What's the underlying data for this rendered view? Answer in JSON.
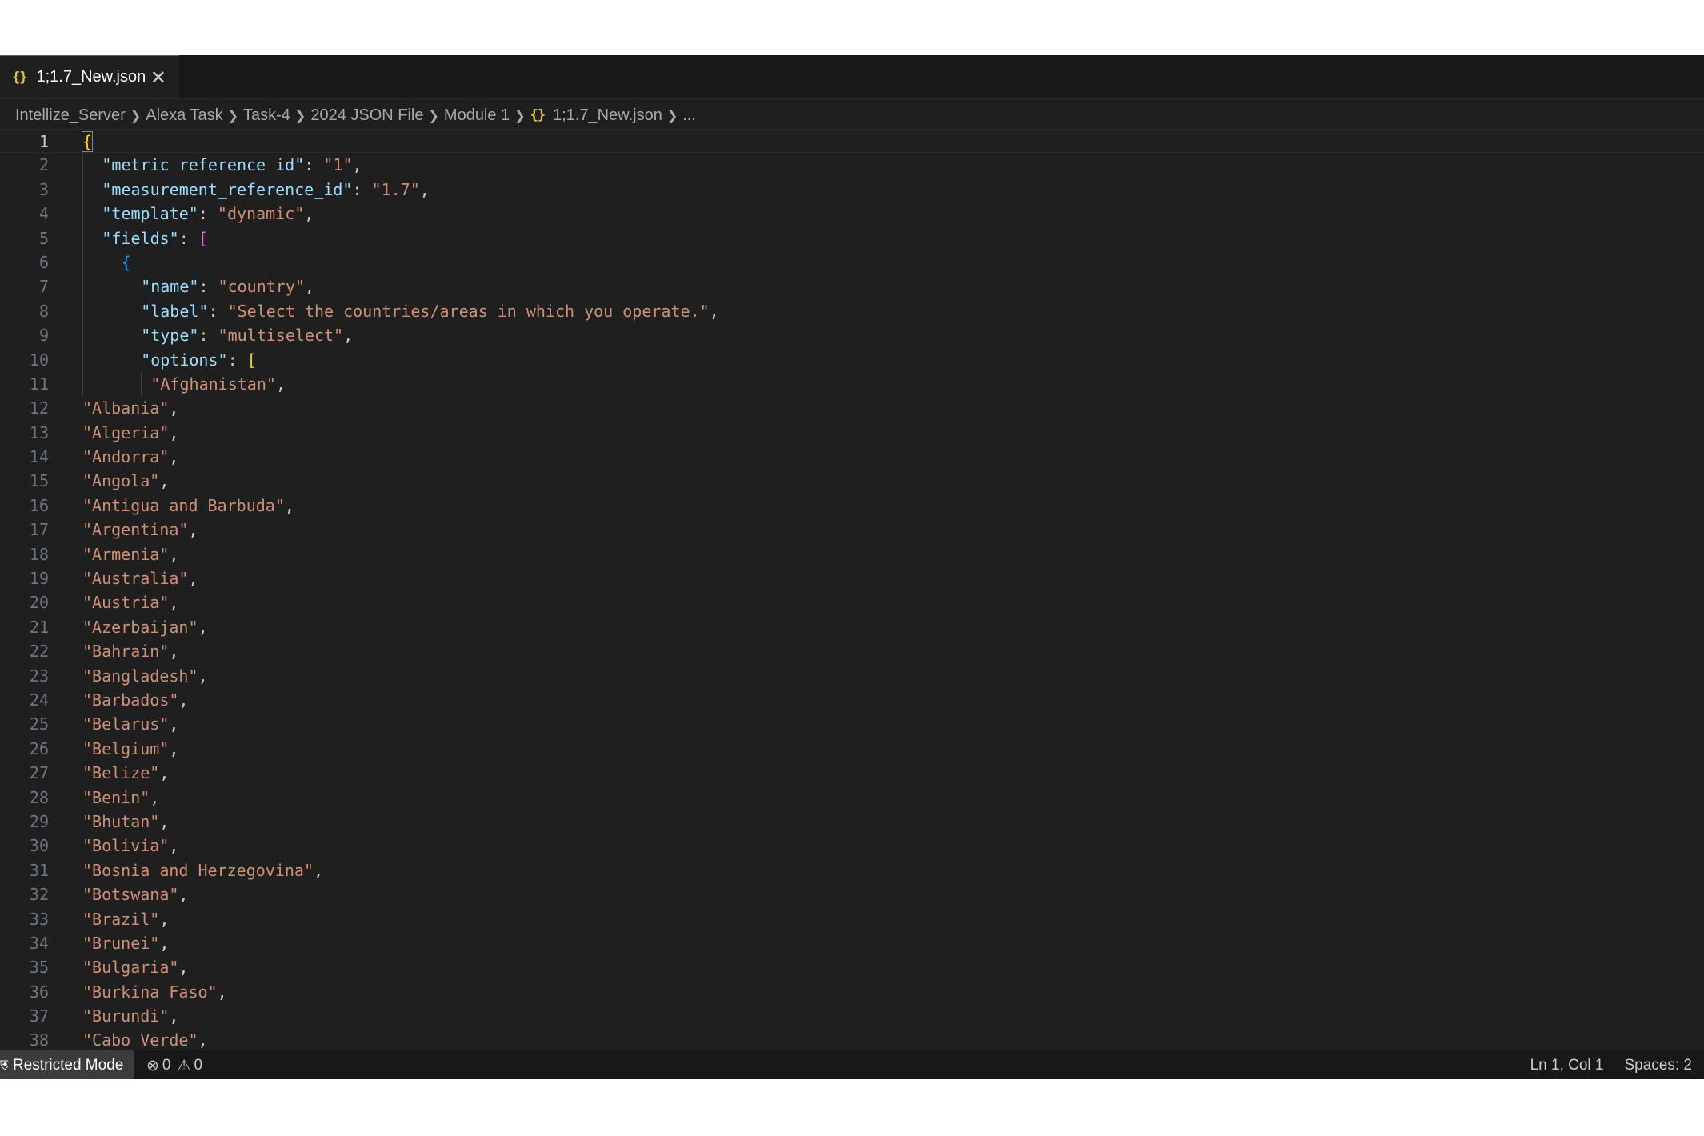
{
  "tab": {
    "icon": "json-braces-icon",
    "icon_text": "{}",
    "filename": "1;1.7_New.json",
    "close_glyph": "✕"
  },
  "breadcrumb": {
    "items": [
      "Intellize_Server",
      "Alexa Task",
      "Task-4",
      "2024 JSON File",
      "Module 1"
    ],
    "file_icon_text": "{}",
    "file": "1;1.7_New.json",
    "more": "..."
  },
  "editor": {
    "lines": [
      {
        "n": "1",
        "current": true,
        "indent": 0,
        "guides": [],
        "tokens": [
          {
            "t": "{",
            "c": "b1 match"
          }
        ]
      },
      {
        "n": "2",
        "indent": 1,
        "guides": [
          0
        ],
        "tokens": [
          {
            "t": "\"metric_reference_id\"",
            "c": "k"
          },
          {
            "t": ": ",
            "c": "p"
          },
          {
            "t": "\"1\"",
            "c": "s"
          },
          {
            "t": ",",
            "c": "p"
          }
        ]
      },
      {
        "n": "3",
        "indent": 1,
        "guides": [
          0
        ],
        "tokens": [
          {
            "t": "\"measurement_reference_id\"",
            "c": "k"
          },
          {
            "t": ": ",
            "c": "p"
          },
          {
            "t": "\"1.7\"",
            "c": "s"
          },
          {
            "t": ",",
            "c": "p"
          }
        ]
      },
      {
        "n": "4",
        "indent": 1,
        "guides": [
          0
        ],
        "tokens": [
          {
            "t": "\"template\"",
            "c": "k"
          },
          {
            "t": ": ",
            "c": "p"
          },
          {
            "t": "\"dynamic\"",
            "c": "s"
          },
          {
            "t": ",",
            "c": "p"
          }
        ]
      },
      {
        "n": "5",
        "indent": 1,
        "guides": [
          0
        ],
        "tokens": [
          {
            "t": "\"fields\"",
            "c": "k"
          },
          {
            "t": ": ",
            "c": "p"
          },
          {
            "t": "[",
            "c": "b2"
          }
        ]
      },
      {
        "n": "6",
        "indent": 2,
        "guides": [
          0,
          1
        ],
        "tokens": [
          {
            "t": "{",
            "c": "b3"
          }
        ]
      },
      {
        "n": "7",
        "indent": 3,
        "guides": [
          0,
          1,
          2
        ],
        "tokens": [
          {
            "t": "\"name\"",
            "c": "k"
          },
          {
            "t": ": ",
            "c": "p"
          },
          {
            "t": "\"country\"",
            "c": "s"
          },
          {
            "t": ",",
            "c": "p"
          }
        ]
      },
      {
        "n": "8",
        "indent": 3,
        "guides": [
          0,
          1,
          2
        ],
        "tokens": [
          {
            "t": "\"label\"",
            "c": "k"
          },
          {
            "t": ": ",
            "c": "p"
          },
          {
            "t": "\"Select the countries/areas in which you operate.\"",
            "c": "s"
          },
          {
            "t": ",",
            "c": "p"
          }
        ]
      },
      {
        "n": "9",
        "indent": 3,
        "guides": [
          0,
          1,
          2
        ],
        "tokens": [
          {
            "t": "\"type\"",
            "c": "k"
          },
          {
            "t": ": ",
            "c": "p"
          },
          {
            "t": "\"multiselect\"",
            "c": "s"
          },
          {
            "t": ",",
            "c": "p"
          }
        ]
      },
      {
        "n": "10",
        "indent": 3,
        "guides": [
          0,
          1,
          2
        ],
        "tokens": [
          {
            "t": "\"options\"",
            "c": "k"
          },
          {
            "t": ": ",
            "c": "p"
          },
          {
            "t": "[",
            "c": "b1"
          }
        ]
      },
      {
        "n": "11",
        "indent": 3.5,
        "guides": [
          0,
          1,
          2,
          3
        ],
        "tokens": [
          {
            "t": "\"Afghanistan\"",
            "c": "s"
          },
          {
            "t": ",",
            "c": "p"
          }
        ]
      },
      {
        "n": "12",
        "indent": 0,
        "guides": [],
        "tokens": [
          {
            "t": "\"Albania\"",
            "c": "s"
          },
          {
            "t": ",",
            "c": "p"
          }
        ]
      },
      {
        "n": "13",
        "indent": 0,
        "guides": [],
        "tokens": [
          {
            "t": "\"Algeria\"",
            "c": "s"
          },
          {
            "t": ",",
            "c": "p"
          }
        ]
      },
      {
        "n": "14",
        "indent": 0,
        "guides": [],
        "tokens": [
          {
            "t": "\"Andorra\"",
            "c": "s"
          },
          {
            "t": ",",
            "c": "p"
          }
        ]
      },
      {
        "n": "15",
        "indent": 0,
        "guides": [],
        "tokens": [
          {
            "t": "\"Angola\"",
            "c": "s"
          },
          {
            "t": ",",
            "c": "p"
          }
        ]
      },
      {
        "n": "16",
        "indent": 0,
        "guides": [],
        "tokens": [
          {
            "t": "\"Antigua and Barbuda\"",
            "c": "s"
          },
          {
            "t": ",",
            "c": "p"
          }
        ]
      },
      {
        "n": "17",
        "indent": 0,
        "guides": [],
        "tokens": [
          {
            "t": "\"Argentina\"",
            "c": "s"
          },
          {
            "t": ",",
            "c": "p"
          }
        ]
      },
      {
        "n": "18",
        "indent": 0,
        "guides": [],
        "tokens": [
          {
            "t": "\"Armenia\"",
            "c": "s"
          },
          {
            "t": ",",
            "c": "p"
          }
        ]
      },
      {
        "n": "19",
        "indent": 0,
        "guides": [],
        "tokens": [
          {
            "t": "\"Australia\"",
            "c": "s"
          },
          {
            "t": ",",
            "c": "p"
          }
        ]
      },
      {
        "n": "20",
        "indent": 0,
        "guides": [],
        "tokens": [
          {
            "t": "\"Austria\"",
            "c": "s"
          },
          {
            "t": ",",
            "c": "p"
          }
        ]
      },
      {
        "n": "21",
        "indent": 0,
        "guides": [],
        "tokens": [
          {
            "t": "\"Azerbaijan\"",
            "c": "s"
          },
          {
            "t": ",",
            "c": "p"
          }
        ]
      },
      {
        "n": "22",
        "indent": 0,
        "guides": [],
        "tokens": [
          {
            "t": "\"Bahrain\"",
            "c": "s"
          },
          {
            "t": ",",
            "c": "p"
          }
        ]
      },
      {
        "n": "23",
        "indent": 0,
        "guides": [],
        "tokens": [
          {
            "t": "\"Bangladesh\"",
            "c": "s"
          },
          {
            "t": ",",
            "c": "p"
          }
        ]
      },
      {
        "n": "24",
        "indent": 0,
        "guides": [],
        "tokens": [
          {
            "t": "\"Barbados\"",
            "c": "s"
          },
          {
            "t": ",",
            "c": "p"
          }
        ]
      },
      {
        "n": "25",
        "indent": 0,
        "guides": [],
        "tokens": [
          {
            "t": "\"Belarus\"",
            "c": "s"
          },
          {
            "t": ",",
            "c": "p"
          }
        ]
      },
      {
        "n": "26",
        "indent": 0,
        "guides": [],
        "tokens": [
          {
            "t": "\"Belgium\"",
            "c": "s"
          },
          {
            "t": ",",
            "c": "p"
          }
        ]
      },
      {
        "n": "27",
        "indent": 0,
        "guides": [],
        "tokens": [
          {
            "t": "\"Belize\"",
            "c": "s"
          },
          {
            "t": ",",
            "c": "p"
          }
        ]
      },
      {
        "n": "28",
        "indent": 0,
        "guides": [],
        "tokens": [
          {
            "t": "\"Benin\"",
            "c": "s"
          },
          {
            "t": ",",
            "c": "p"
          }
        ]
      },
      {
        "n": "29",
        "indent": 0,
        "guides": [],
        "tokens": [
          {
            "t": "\"Bhutan\"",
            "c": "s"
          },
          {
            "t": ",",
            "c": "p"
          }
        ]
      },
      {
        "n": "30",
        "indent": 0,
        "guides": [],
        "tokens": [
          {
            "t": "\"Bolivia\"",
            "c": "s"
          },
          {
            "t": ",",
            "c": "p"
          }
        ]
      },
      {
        "n": "31",
        "indent": 0,
        "guides": [],
        "tokens": [
          {
            "t": "\"Bosnia and Herzegovina\"",
            "c": "s"
          },
          {
            "t": ",",
            "c": "p"
          }
        ]
      },
      {
        "n": "32",
        "indent": 0,
        "guides": [],
        "tokens": [
          {
            "t": "\"Botswana\"",
            "c": "s"
          },
          {
            "t": ",",
            "c": "p"
          }
        ]
      },
      {
        "n": "33",
        "indent": 0,
        "guides": [],
        "tokens": [
          {
            "t": "\"Brazil\"",
            "c": "s"
          },
          {
            "t": ",",
            "c": "p"
          }
        ]
      },
      {
        "n": "34",
        "indent": 0,
        "guides": [],
        "tokens": [
          {
            "t": "\"Brunei\"",
            "c": "s"
          },
          {
            "t": ",",
            "c": "p"
          }
        ]
      },
      {
        "n": "35",
        "indent": 0,
        "guides": [],
        "tokens": [
          {
            "t": "\"Bulgaria\"",
            "c": "s"
          },
          {
            "t": ",",
            "c": "p"
          }
        ]
      },
      {
        "n": "36",
        "indent": 0,
        "guides": [],
        "tokens": [
          {
            "t": "\"Burkina Faso\"",
            "c": "s"
          },
          {
            "t": ",",
            "c": "p"
          }
        ]
      },
      {
        "n": "37",
        "indent": 0,
        "guides": [],
        "tokens": [
          {
            "t": "\"Burundi\"",
            "c": "s"
          },
          {
            "t": ",",
            "c": "p"
          }
        ]
      },
      {
        "n": "38",
        "indent": 0,
        "guides": [],
        "tokens": [
          {
            "t": "\"Cabo Verde\"",
            "c": "s"
          },
          {
            "t": ",",
            "c": "p"
          }
        ]
      }
    ]
  },
  "statusbar": {
    "restricted_mode": "Restricted Mode",
    "errors": "0",
    "warnings": "0",
    "cursor_position": "Ln 1, Col 1",
    "indentation": "Spaces: 2"
  },
  "colors": {
    "editor_bg": "#1f1f1f",
    "key": "#9cdcfe",
    "string": "#ce9178",
    "bracket_gold": "#ffd700",
    "bracket_purple": "#da70d6",
    "bracket_blue": "#179fff"
  }
}
